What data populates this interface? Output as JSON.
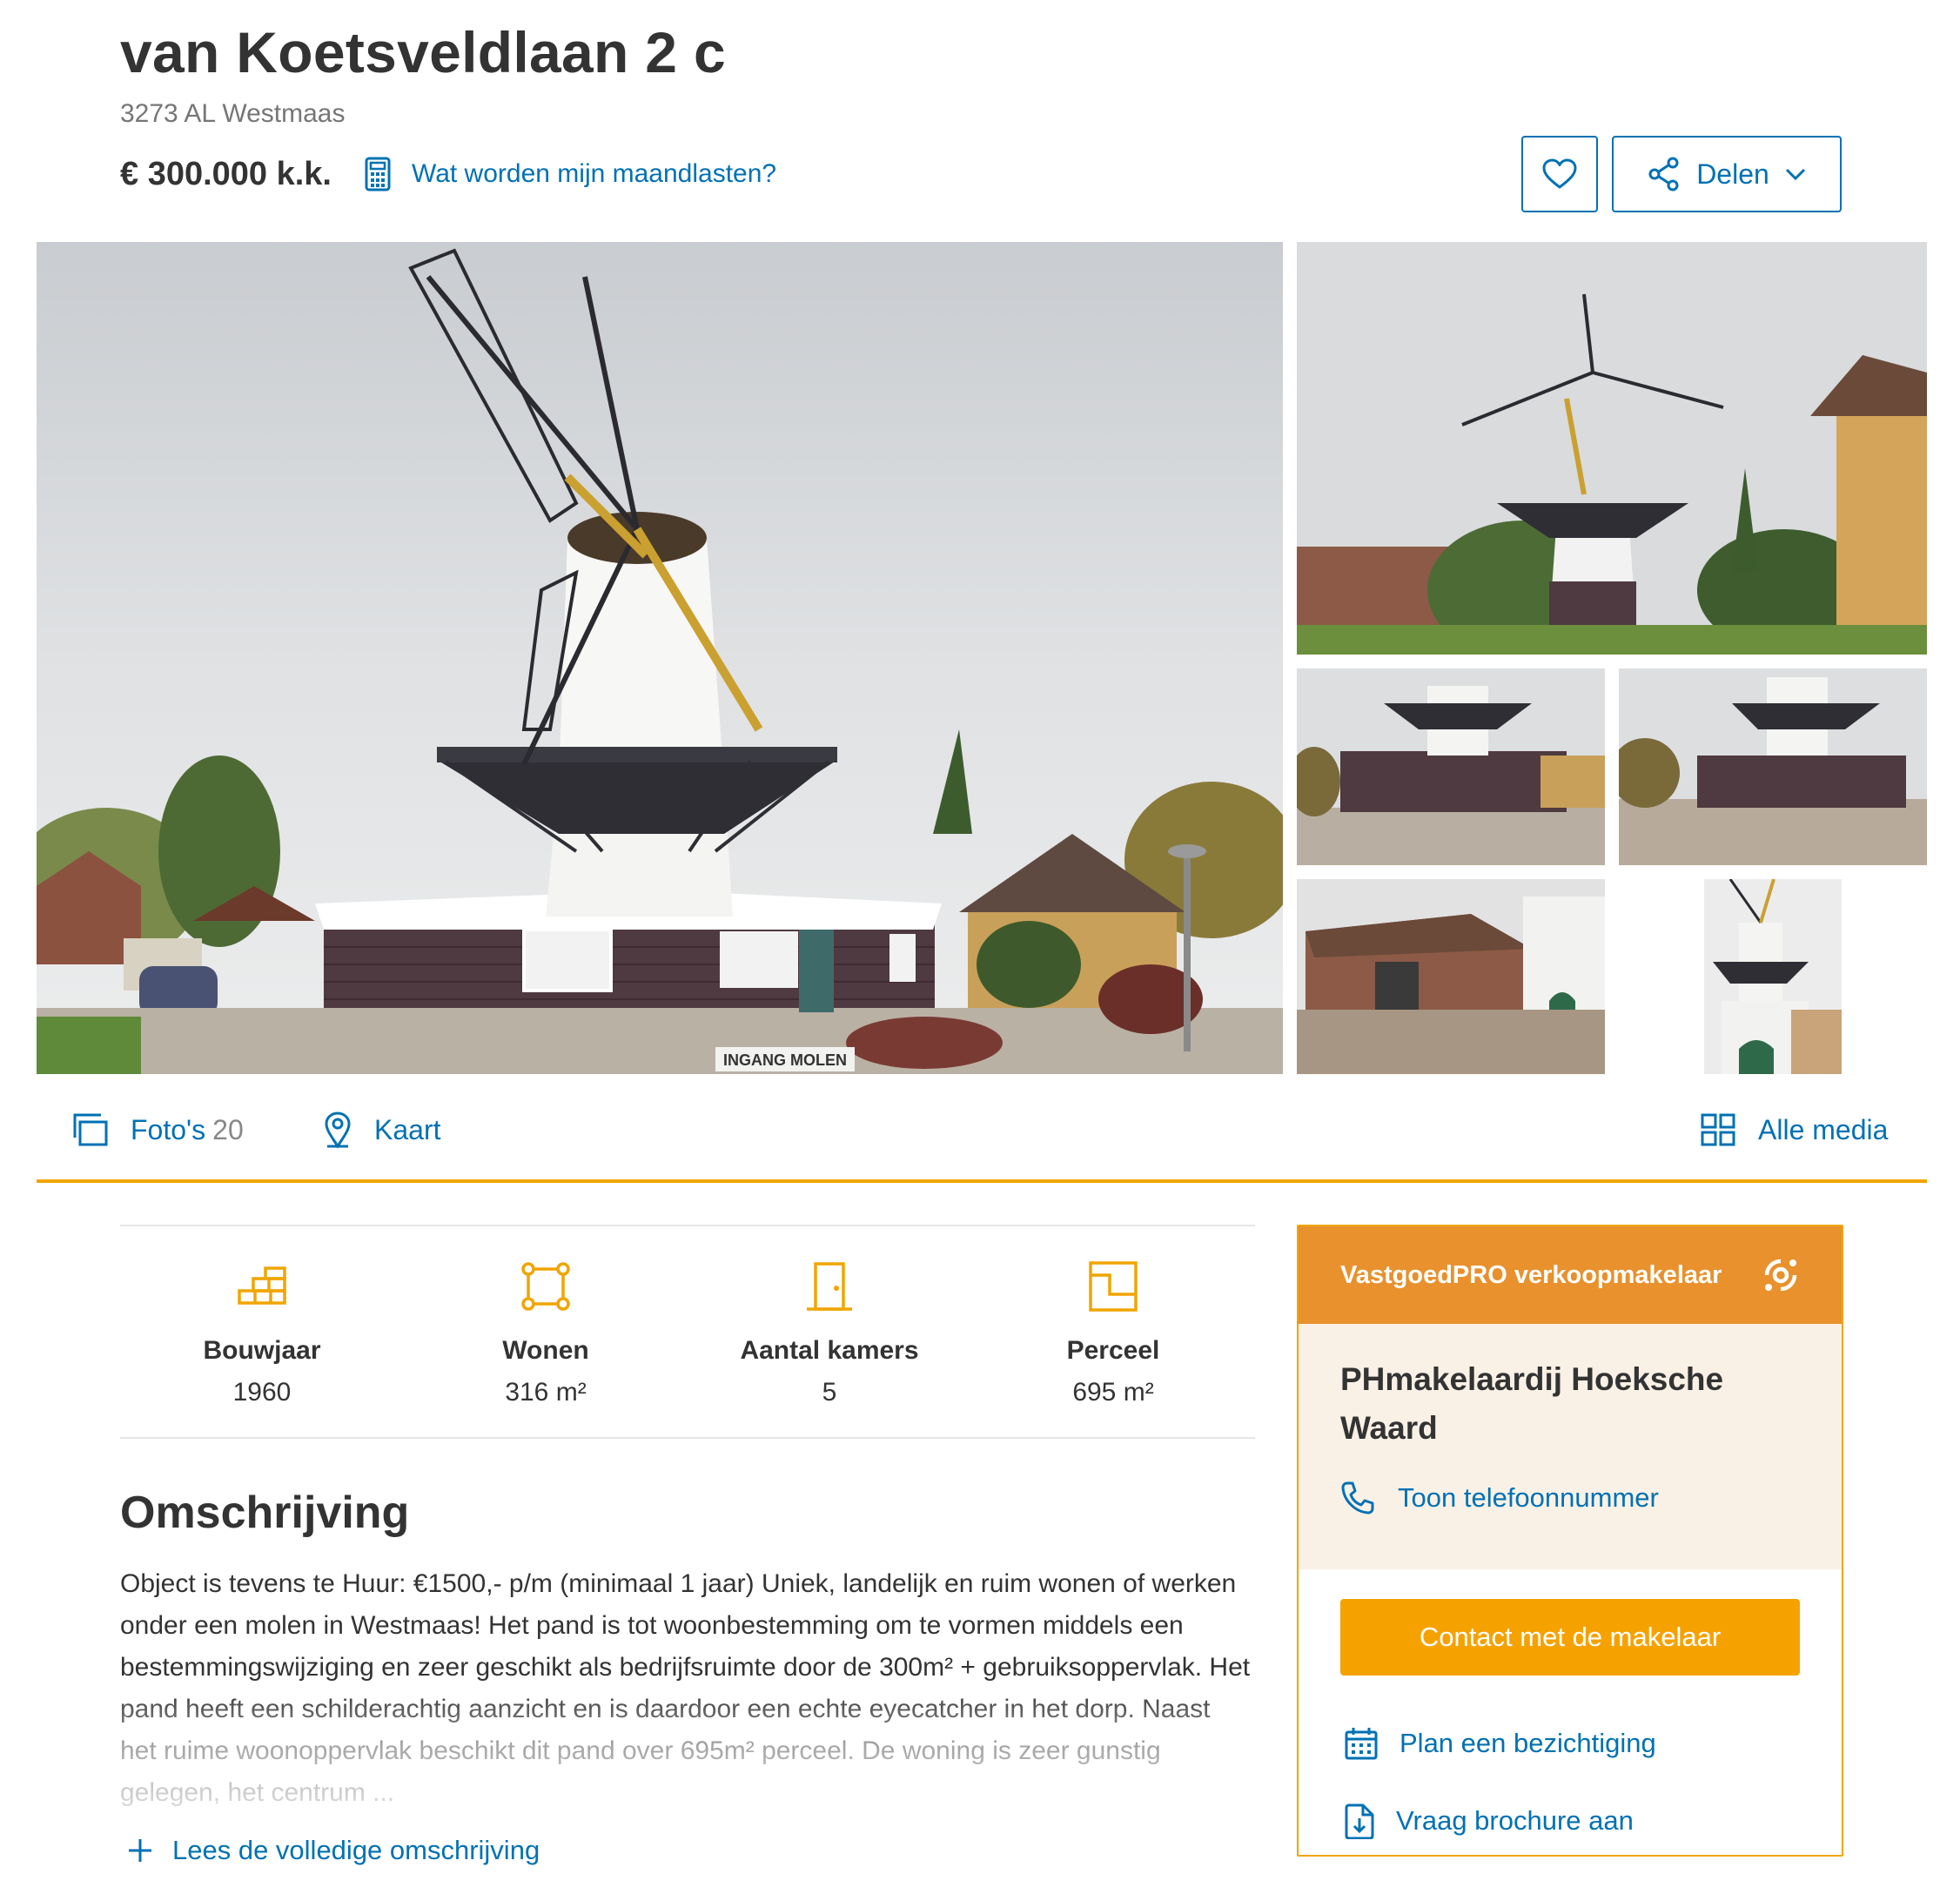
{
  "listing": {
    "title": "van Koetsveldlaan 2 c",
    "postal": "3273 AL Westmaas",
    "price": "€ 300.000 k.k.",
    "mortgage_link": "Wat worden mijn maandlasten?",
    "share_label": "Delen"
  },
  "photos": {
    "main_sign_text": "INGANG MOLEN"
  },
  "media_bar": {
    "photos_label": "Foto's",
    "photos_count": "20",
    "map_label": "Kaart",
    "all_media_label": "Alle media"
  },
  "features": [
    {
      "label": "Bouwjaar",
      "value": "1960",
      "icon": "bricks-icon"
    },
    {
      "label": "Wonen",
      "value": "316 m²",
      "icon": "area-icon"
    },
    {
      "label": "Aantal kamers",
      "value": "5",
      "icon": "door-icon"
    },
    {
      "label": "Perceel",
      "value": "695 m²",
      "icon": "plot-icon"
    }
  ],
  "description": {
    "heading": "Omschrijving",
    "text": "Object is tevens te Huur: €1500,- p/m (minimaal 1 jaar) Uniek, landelijk en ruim wonen of werken onder een molen in Westmaas! Het pand is tot woonbestemming om te vormen middels een bestemmingswijziging en zeer geschikt als bedrijfsruimte door de 300m² + gebruiksoppervlak. Het pand heeft een schilderachtig aanzicht en is daardoor een echte eyecatcher in het dorp. Naast het ruime woonoppervlak beschikt dit pand over 695m² perceel. De woning is zeer gunstig gelegen, het centrum ...",
    "read_more": "Lees de volledige omschrijving"
  },
  "agent": {
    "header": "VastgoedPRO verkoopmakelaar",
    "office": "PHmakelaardij Hoeksche Waard",
    "phone_link": "Toon telefoonnummer",
    "contact_button": "Contact met de makelaar",
    "viewing_link": "Plan een bezichtiging",
    "brochure_link": "Vraag brochure aan"
  },
  "colors": {
    "link_blue": "#0071b3",
    "accent_orange": "#f0a500",
    "agent_header": "#e8912d",
    "agent_bg": "#faf1e6",
    "button_orange": "#f5a201"
  }
}
